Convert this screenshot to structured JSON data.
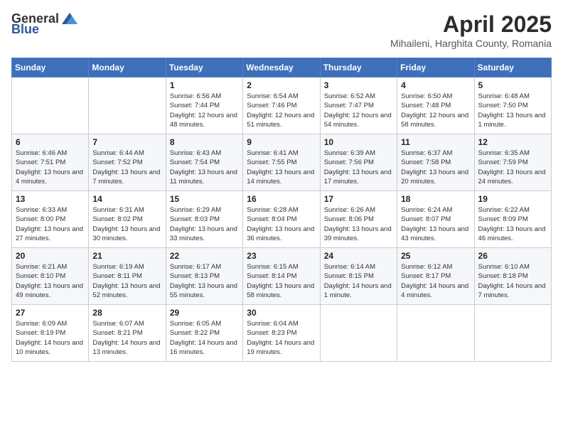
{
  "logo": {
    "general": "General",
    "blue": "Blue"
  },
  "header": {
    "month": "April 2025",
    "location": "Mihaileni, Harghita County, Romania"
  },
  "weekdays": [
    "Sunday",
    "Monday",
    "Tuesday",
    "Wednesday",
    "Thursday",
    "Friday",
    "Saturday"
  ],
  "weeks": [
    [
      {
        "day": "",
        "info": ""
      },
      {
        "day": "",
        "info": ""
      },
      {
        "day": "1",
        "info": "Sunrise: 6:56 AM\nSunset: 7:44 PM\nDaylight: 12 hours and 48 minutes."
      },
      {
        "day": "2",
        "info": "Sunrise: 6:54 AM\nSunset: 7:46 PM\nDaylight: 12 hours and 51 minutes."
      },
      {
        "day": "3",
        "info": "Sunrise: 6:52 AM\nSunset: 7:47 PM\nDaylight: 12 hours and 54 minutes."
      },
      {
        "day": "4",
        "info": "Sunrise: 6:50 AM\nSunset: 7:48 PM\nDaylight: 12 hours and 58 minutes."
      },
      {
        "day": "5",
        "info": "Sunrise: 6:48 AM\nSunset: 7:50 PM\nDaylight: 13 hours and 1 minute."
      }
    ],
    [
      {
        "day": "6",
        "info": "Sunrise: 6:46 AM\nSunset: 7:51 PM\nDaylight: 13 hours and 4 minutes."
      },
      {
        "day": "7",
        "info": "Sunrise: 6:44 AM\nSunset: 7:52 PM\nDaylight: 13 hours and 7 minutes."
      },
      {
        "day": "8",
        "info": "Sunrise: 6:43 AM\nSunset: 7:54 PM\nDaylight: 13 hours and 11 minutes."
      },
      {
        "day": "9",
        "info": "Sunrise: 6:41 AM\nSunset: 7:55 PM\nDaylight: 13 hours and 14 minutes."
      },
      {
        "day": "10",
        "info": "Sunrise: 6:39 AM\nSunset: 7:56 PM\nDaylight: 13 hours and 17 minutes."
      },
      {
        "day": "11",
        "info": "Sunrise: 6:37 AM\nSunset: 7:58 PM\nDaylight: 13 hours and 20 minutes."
      },
      {
        "day": "12",
        "info": "Sunrise: 6:35 AM\nSunset: 7:59 PM\nDaylight: 13 hours and 24 minutes."
      }
    ],
    [
      {
        "day": "13",
        "info": "Sunrise: 6:33 AM\nSunset: 8:00 PM\nDaylight: 13 hours and 27 minutes."
      },
      {
        "day": "14",
        "info": "Sunrise: 6:31 AM\nSunset: 8:02 PM\nDaylight: 13 hours and 30 minutes."
      },
      {
        "day": "15",
        "info": "Sunrise: 6:29 AM\nSunset: 8:03 PM\nDaylight: 13 hours and 33 minutes."
      },
      {
        "day": "16",
        "info": "Sunrise: 6:28 AM\nSunset: 8:04 PM\nDaylight: 13 hours and 36 minutes."
      },
      {
        "day": "17",
        "info": "Sunrise: 6:26 AM\nSunset: 8:06 PM\nDaylight: 13 hours and 39 minutes."
      },
      {
        "day": "18",
        "info": "Sunrise: 6:24 AM\nSunset: 8:07 PM\nDaylight: 13 hours and 43 minutes."
      },
      {
        "day": "19",
        "info": "Sunrise: 6:22 AM\nSunset: 8:09 PM\nDaylight: 13 hours and 46 minutes."
      }
    ],
    [
      {
        "day": "20",
        "info": "Sunrise: 6:21 AM\nSunset: 8:10 PM\nDaylight: 13 hours and 49 minutes."
      },
      {
        "day": "21",
        "info": "Sunrise: 6:19 AM\nSunset: 8:11 PM\nDaylight: 13 hours and 52 minutes."
      },
      {
        "day": "22",
        "info": "Sunrise: 6:17 AM\nSunset: 8:13 PM\nDaylight: 13 hours and 55 minutes."
      },
      {
        "day": "23",
        "info": "Sunrise: 6:15 AM\nSunset: 8:14 PM\nDaylight: 13 hours and 58 minutes."
      },
      {
        "day": "24",
        "info": "Sunrise: 6:14 AM\nSunset: 8:15 PM\nDaylight: 14 hours and 1 minute."
      },
      {
        "day": "25",
        "info": "Sunrise: 6:12 AM\nSunset: 8:17 PM\nDaylight: 14 hours and 4 minutes."
      },
      {
        "day": "26",
        "info": "Sunrise: 6:10 AM\nSunset: 8:18 PM\nDaylight: 14 hours and 7 minutes."
      }
    ],
    [
      {
        "day": "27",
        "info": "Sunrise: 6:09 AM\nSunset: 8:19 PM\nDaylight: 14 hours and 10 minutes."
      },
      {
        "day": "28",
        "info": "Sunrise: 6:07 AM\nSunset: 8:21 PM\nDaylight: 14 hours and 13 minutes."
      },
      {
        "day": "29",
        "info": "Sunrise: 6:05 AM\nSunset: 8:22 PM\nDaylight: 14 hours and 16 minutes."
      },
      {
        "day": "30",
        "info": "Sunrise: 6:04 AM\nSunset: 8:23 PM\nDaylight: 14 hours and 19 minutes."
      },
      {
        "day": "",
        "info": ""
      },
      {
        "day": "",
        "info": ""
      },
      {
        "day": "",
        "info": ""
      }
    ]
  ]
}
